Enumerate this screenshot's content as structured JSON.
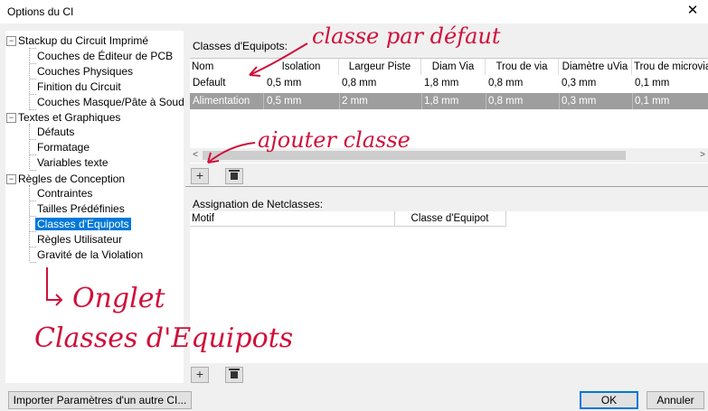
{
  "window": {
    "title": "Options du CI",
    "close_glyph": "✕"
  },
  "tree": {
    "groups": [
      {
        "label": "Stackup du Circuit Imprimé",
        "children": [
          "Couches de Éditeur de PCB",
          "Couches Physiques",
          "Finition du Circuit",
          "Couches Masque/Pâte à Souder"
        ]
      },
      {
        "label": "Textes et Graphiques",
        "children": [
          "Défauts",
          "Formatage",
          "Variables texte"
        ]
      },
      {
        "label": "Règles de Conception",
        "children": [
          "Contraintes",
          "Tailles Prédéfinies",
          "Classes d'Equipots",
          "Règles Utilisateur",
          "Gravité de la Violation"
        ]
      }
    ],
    "selected": "Classes d'Equipots",
    "expander_glyph": "−"
  },
  "netclasses": {
    "label": "Classes d'Equipots:",
    "columns": [
      "Nom",
      "Isolation",
      "Largeur Piste",
      "Diam Via",
      "Trou de via",
      "Diamètre uVia",
      "Trou de microvia"
    ],
    "rows": [
      [
        "Default",
        "0,5 mm",
        "0,8 mm",
        "1,8 mm",
        "0,8 mm",
        "0,3 mm",
        "0,1 mm"
      ],
      [
        "Alimentation",
        "0,5 mm",
        "2 mm",
        "1,8 mm",
        "0,8 mm",
        "0,3 mm",
        "0,1 mm"
      ]
    ],
    "scroll_left": "<",
    "scroll_right": ">"
  },
  "assignment": {
    "label": "Assignation de Netclasses:",
    "columns": [
      "Motif",
      "Classe d'Equipot"
    ]
  },
  "icons": {
    "add": "+",
    "delete": "trash-icon"
  },
  "buttons": {
    "import": "Importer Paramètres d'un autre CI...",
    "ok": "OK",
    "cancel": "Annuler"
  },
  "annotations": {
    "default_class": "classe par défaut",
    "add_class": "ajouter classe",
    "tab_line1": "Onglet",
    "tab_line2": "Classes d'Equipots",
    "color": "#d0103a"
  }
}
